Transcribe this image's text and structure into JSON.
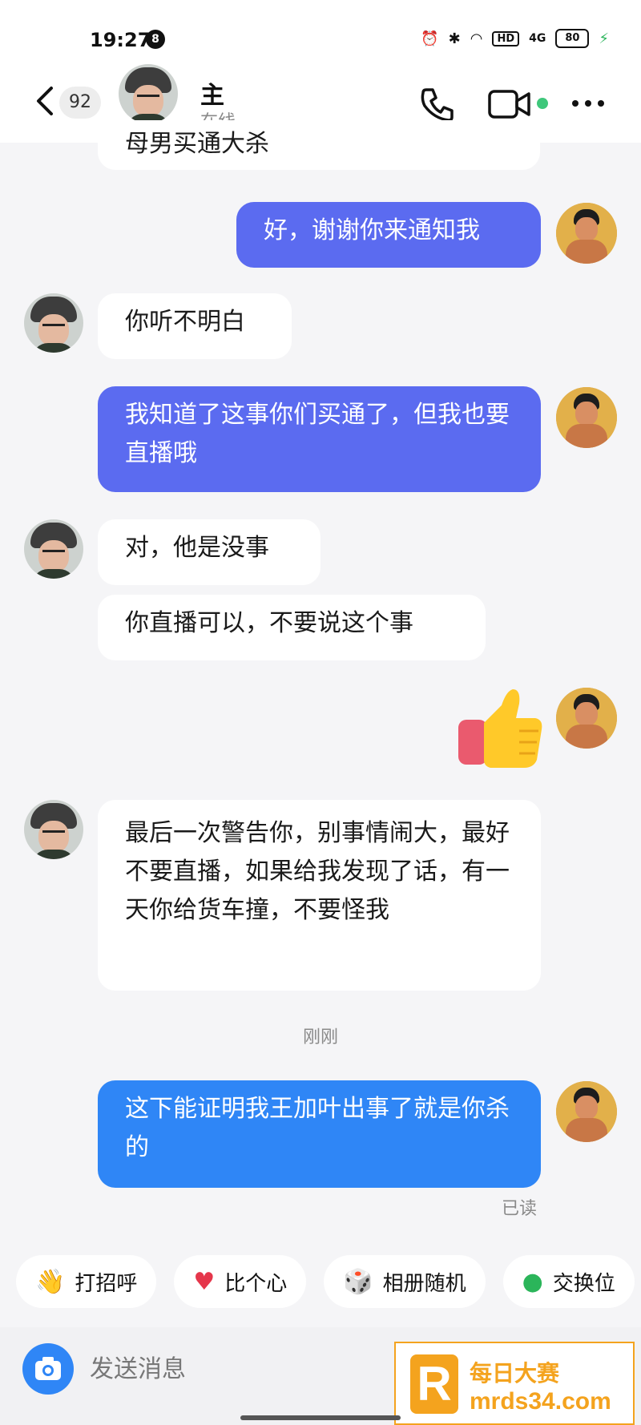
{
  "status_bar": {
    "time": "19:27",
    "notification_count": "8",
    "hd": "HD",
    "network": "4G",
    "battery": "80"
  },
  "header": {
    "back_count": "92",
    "contact_name": "主",
    "contact_status": "在线"
  },
  "messages": {
    "m0": "母男买通大杀",
    "m1": "好，谢谢你来通知我",
    "m2": "你听不明白",
    "m3": "我知道了这事你们买通了，但我也要直播哦",
    "m4": "对，他是没事",
    "m5": "你直播可以，不要说这个事",
    "m6": "最后一次警告你，别事情闹大，最好不要直播，如果给我发现了话，有一天你给货车撞，不要怪我",
    "m7": "这下能证明我王加叶出事了就是你杀的"
  },
  "timestamp": "刚刚",
  "read_receipt": "已读",
  "chips": [
    {
      "icon": "wave-icon",
      "label": "打招呼"
    },
    {
      "icon": "heart-icon",
      "label": "比个心"
    },
    {
      "icon": "dice-icon",
      "label": "相册随机"
    },
    {
      "icon": "location-icon",
      "label": "交换位"
    }
  ],
  "input": {
    "placeholder": "发送消息"
  },
  "watermark": {
    "logo": "R",
    "line1": "每日大赛",
    "line2": "mrds34.com"
  },
  "colors": {
    "outgoing_purple": "#5b6bf0",
    "outgoing_blue": "#2f86f6",
    "online": "#3fc77b"
  }
}
